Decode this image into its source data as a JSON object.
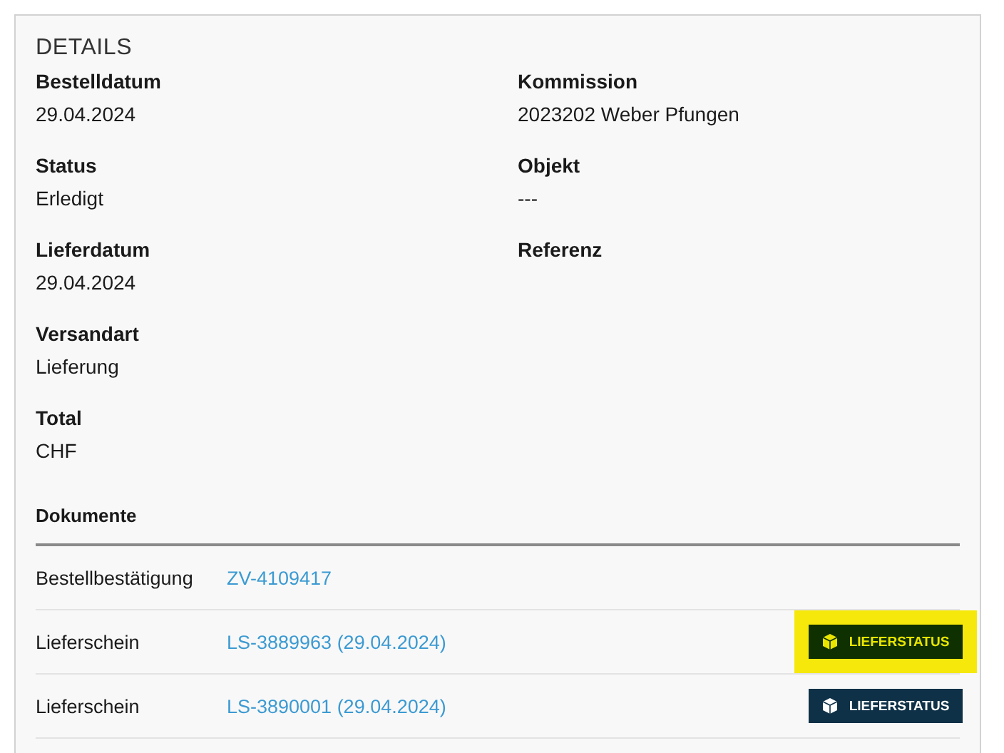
{
  "panel": {
    "title": "DETAILS",
    "left_column": [
      {
        "label": "Bestelldatum",
        "value": "29.04.2024"
      },
      {
        "label": "Status",
        "value": "Erledigt"
      },
      {
        "label": "Lieferdatum",
        "value": "29.04.2024"
      },
      {
        "label": "Versandart",
        "value": "Lieferung"
      },
      {
        "label": "Total",
        "value": "CHF"
      }
    ],
    "right_column": [
      {
        "label": "Kommission",
        "value": "2023202 Weber Pfungen"
      },
      {
        "label": "Objekt",
        "value": "---"
      },
      {
        "label": "Referenz"
      }
    ],
    "documents": {
      "title": "Dokumente",
      "rows": [
        {
          "type": "Bestellbestätigung",
          "link": "ZV-4109417"
        },
        {
          "type": "Lieferschein",
          "link": "LS-3889963 (29.04.2024)",
          "button": "LIEFERSTATUS",
          "highlighted": true
        },
        {
          "type": "Lieferschein",
          "link": "LS-3890001 (29.04.2024)",
          "button": "LIEFERSTATUS",
          "highlighted": false
        }
      ]
    }
  }
}
